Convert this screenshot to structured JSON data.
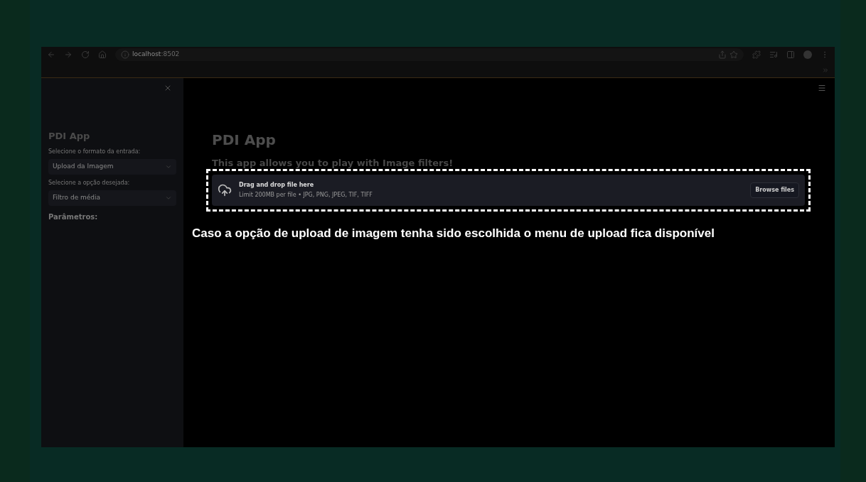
{
  "browser": {
    "url_host": "localhost",
    "url_port": ":8502"
  },
  "sidebar": {
    "title": "PDI App",
    "fields": [
      {
        "label": "Selecione o formato da entrada:",
        "value": "Upload da Imagem"
      },
      {
        "label": "Selecione a opção desejada:",
        "value": "Filtro de média"
      }
    ],
    "section": "Parâmetros:"
  },
  "main": {
    "title": "PDI App",
    "subtitle": "This app allows you to play with Image filters!",
    "uploader": {
      "heading": "Drag and drop file here",
      "limits": "Limit 200MB per file • JPG, PNG, JPEG, TIF, TIFF",
      "button": "Browse files"
    }
  },
  "annotation": "Caso a opção de upload de imagem tenha sido escolhida o menu de upload fica disponível"
}
